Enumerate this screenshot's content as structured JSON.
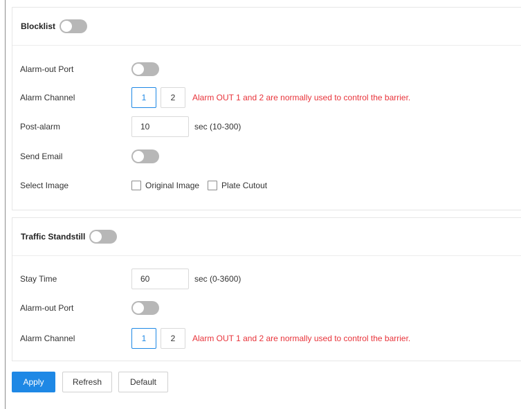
{
  "blocklist": {
    "title": "Blocklist",
    "toggle_on": false,
    "alarm_out_port_label": "Alarm-out Port",
    "alarm_out_port_on": false,
    "alarm_channel_label": "Alarm Channel",
    "channels": [
      "1",
      "2"
    ],
    "selected_channel": "1",
    "channel_note": "Alarm OUT 1 and 2 are normally used to control the barrier.",
    "post_alarm_label": "Post-alarm",
    "post_alarm_value": "10",
    "post_alarm_unit": "sec (10-300)",
    "send_email_label": "Send Email",
    "send_email_on": false,
    "select_image_label": "Select Image",
    "image_options": [
      "Original Image",
      "Plate Cutout"
    ]
  },
  "traffic_standstill": {
    "title": "Traffic Standstill",
    "toggle_on": false,
    "stay_time_label": "Stay Time",
    "stay_time_value": "60",
    "stay_time_unit": "sec (0-3600)",
    "alarm_out_port_label": "Alarm-out Port",
    "alarm_out_port_on": false,
    "alarm_channel_label": "Alarm Channel",
    "channels": [
      "1",
      "2"
    ],
    "selected_channel": "1",
    "channel_note": "Alarm OUT 1 and 2 are normally used to control the barrier."
  },
  "actions": {
    "apply": "Apply",
    "refresh": "Refresh",
    "default": "Default"
  },
  "colors": {
    "accent": "#1e88e5",
    "warning": "#e8333a",
    "toggle_off": "#b7b7b7"
  }
}
